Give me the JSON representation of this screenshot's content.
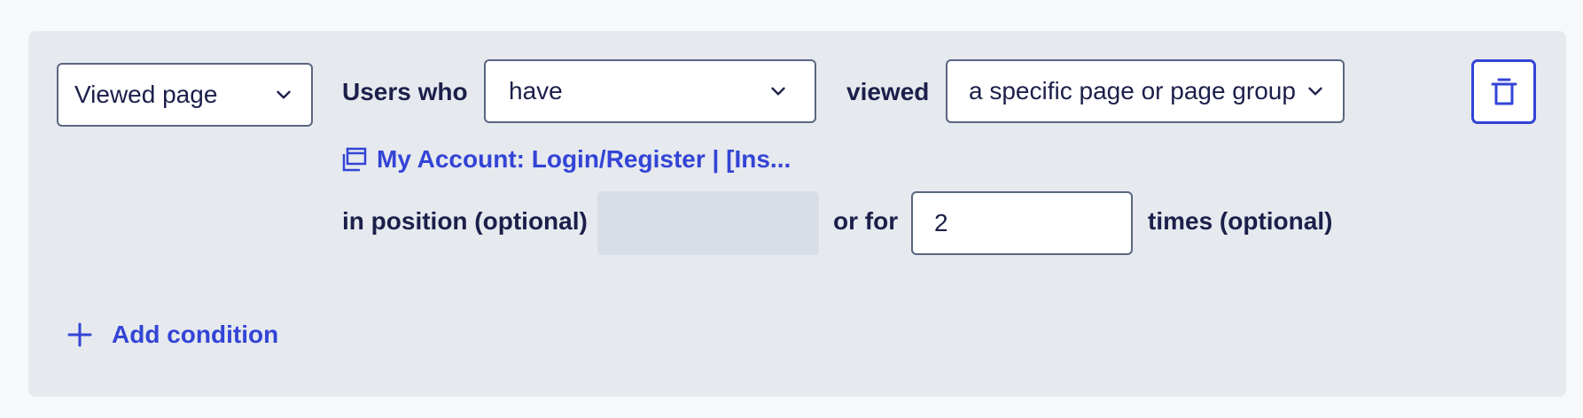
{
  "condition": {
    "event_select": {
      "value": "Viewed page"
    },
    "users_who_label": "Users who",
    "have_select": {
      "value": "have"
    },
    "viewed_label": "viewed",
    "page_select": {
      "value": "a specific page or page group"
    },
    "page_link": "My Account: Login/Register | [Ins...",
    "position_label": "in position (optional)",
    "position_input": {
      "value": ""
    },
    "or_for_label": "or for",
    "times_input": {
      "value": "2"
    },
    "times_label": "times (optional)"
  },
  "add_condition": {
    "label": "Add condition"
  },
  "colors": {
    "panel_bg": "#e6e9ee",
    "accent": "#3344d6",
    "text": "#1c1f4a",
    "border": "#5a6680",
    "disabled_bg": "#d8dee6"
  },
  "icons": {
    "chevron": "chevron-down-icon",
    "page_group": "page-group-icon",
    "plus": "plus-icon",
    "trash": "trash-icon"
  }
}
